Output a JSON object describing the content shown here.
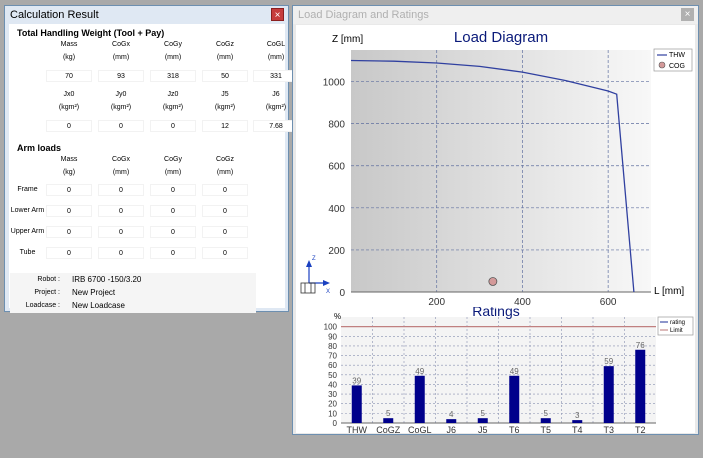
{
  "calc": {
    "title": "Calculation Result",
    "close": "×",
    "thw_title": "Total Handling Weight (Tool + Pay)",
    "thw_headers": [
      {
        "name": "Mass",
        "unit": "(kg)"
      },
      {
        "name": "CoGx",
        "unit": "(mm)"
      },
      {
        "name": "CoGy",
        "unit": "(mm)"
      },
      {
        "name": "CoGz",
        "unit": "(mm)"
      },
      {
        "name": "CoGL",
        "unit": "(mm)"
      }
    ],
    "thw_values": [
      "70",
      "93",
      "318",
      "50",
      "331"
    ],
    "inertia_headers": [
      {
        "name": "Jx0",
        "unit": "(kgm²)"
      },
      {
        "name": "Jy0",
        "unit": "(kgm²)"
      },
      {
        "name": "Jz0",
        "unit": "(kgm²)"
      },
      {
        "name": "J5",
        "unit": "(kgm²)"
      },
      {
        "name": "J6",
        "unit": "(kgm²)"
      }
    ],
    "inertia_values": [
      "0",
      "0",
      "0",
      "12",
      "7.68"
    ],
    "arm_title": "Arm loads",
    "arm_headers": [
      {
        "name": "Mass",
        "unit": "(kg)"
      },
      {
        "name": "CoGx",
        "unit": "(mm)"
      },
      {
        "name": "CoGy",
        "unit": "(mm)"
      },
      {
        "name": "CoGz",
        "unit": "(mm)"
      }
    ],
    "arm_rows": [
      {
        "label": "Frame",
        "values": [
          "0",
          "0",
          "0",
          "0"
        ]
      },
      {
        "label": "Lower Arm",
        "values": [
          "0",
          "0",
          "0",
          "0"
        ]
      },
      {
        "label": "Upper Arm",
        "values": [
          "0",
          "0",
          "0",
          "0"
        ]
      },
      {
        "label": "Tube",
        "values": [
          "0",
          "0",
          "0",
          "0"
        ]
      }
    ],
    "info": [
      {
        "label": "Robot :",
        "value": "IRB 6700 -150/3.20"
      },
      {
        "label": "Project :",
        "value": "New Project"
      },
      {
        "label": "Loadcase :",
        "value": "New Loadcase"
      }
    ]
  },
  "load": {
    "title": "Load Diagram and Ratings",
    "close": "×"
  },
  "chart_data": [
    {
      "type": "line",
      "title": "Load Diagram",
      "ylabel": "Z [mm]",
      "xlabel": "L [mm]",
      "xlim": [
        0,
        700
      ],
      "ylim": [
        0,
        1150
      ],
      "xticks": [
        200,
        400,
        600
      ],
      "yticks": [
        0,
        200,
        400,
        600,
        800,
        1000
      ],
      "legend": [
        "THW",
        "COG"
      ],
      "legend_position": "top-right",
      "grid": true,
      "series": [
        {
          "name": "THW",
          "x": [
            0,
            100,
            200,
            300,
            400,
            500,
            600,
            620,
            640,
            660
          ],
          "y": [
            1100,
            1097,
            1088,
            1072,
            1045,
            1005,
            955,
            940,
            470,
            0
          ]
        }
      ],
      "cog": {
        "name": "COG",
        "x": 331,
        "y": 50
      }
    },
    {
      "type": "bar",
      "title": "Ratings",
      "ylabel": "%",
      "ylim": [
        0,
        110
      ],
      "yticks": [
        0,
        10,
        20,
        30,
        40,
        50,
        60,
        70,
        80,
        90,
        100
      ],
      "categories": [
        "THW",
        "CoGZ",
        "CoGL",
        "J6",
        "J5",
        "T6",
        "T5",
        "T4",
        "T3",
        "T2"
      ],
      "values": [
        39,
        5,
        49,
        4,
        5,
        49,
        5,
        3,
        59,
        76
      ],
      "limit": 100,
      "legend": [
        "rating",
        "Limit"
      ],
      "legend_position": "top-right",
      "colors": {
        "bar": "#00008b",
        "limit": "#c08080",
        "line": "#3040a0"
      }
    }
  ]
}
